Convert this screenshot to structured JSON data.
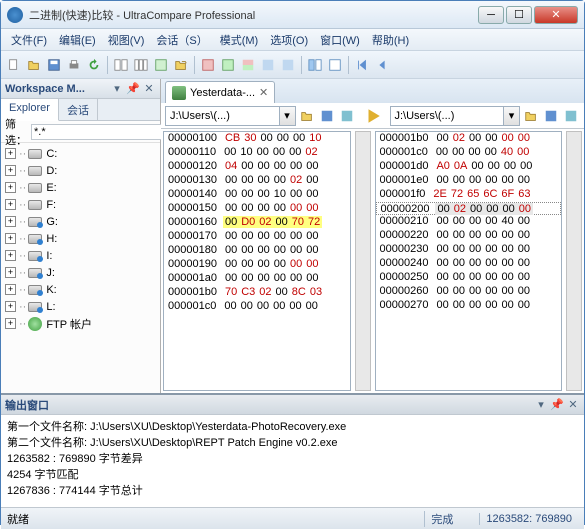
{
  "window": {
    "title": "二进制(快速)比较 - UltraCompare Professional"
  },
  "menu": [
    "文件(F)",
    "编辑(E)",
    "视图(V)",
    "会话（S）",
    "模式(M)",
    "选项(O)",
    "窗口(W)",
    "帮助(H)"
  ],
  "workspace_panel": {
    "title": "Workspace M...",
    "tabs": [
      "Explorer",
      "会话"
    ],
    "filter_label": "筛选：",
    "filter_value": "*.*",
    "drives": [
      {
        "label": "C:",
        "type": "local"
      },
      {
        "label": "D:",
        "type": "local"
      },
      {
        "label": "E:",
        "type": "local"
      },
      {
        "label": "F:",
        "type": "local"
      },
      {
        "label": "G:",
        "type": "net"
      },
      {
        "label": "H:",
        "type": "net"
      },
      {
        "label": "I:",
        "type": "net"
      },
      {
        "label": "J:",
        "type": "net"
      },
      {
        "label": "K:",
        "type": "net"
      },
      {
        "label": "L:",
        "type": "net"
      },
      {
        "label": "FTP 帐户",
        "type": "ftp"
      }
    ]
  },
  "doc_tab": "Yesterdata-...",
  "paths": {
    "left": "J:\\Users\\(...)",
    "right": "J:\\Users\\(...)"
  },
  "hex_left": [
    {
      "addr": "00000100",
      "bytes": [
        [
          "CB",
          "r"
        ],
        [
          "30",
          "r"
        ],
        [
          "00",
          "n"
        ],
        [
          "00",
          "n"
        ],
        [
          "00",
          "n"
        ],
        [
          "10",
          "r"
        ]
      ]
    },
    {
      "addr": "00000110",
      "bytes": [
        [
          "00",
          "n"
        ],
        [
          "10",
          "n"
        ],
        [
          "00",
          "n"
        ],
        [
          "00",
          "n"
        ],
        [
          "00",
          "n"
        ],
        [
          "02",
          "r"
        ]
      ]
    },
    {
      "addr": "00000120",
      "bytes": [
        [
          "04",
          "r"
        ],
        [
          "00",
          "n"
        ],
        [
          "00",
          "n"
        ],
        [
          "00",
          "n"
        ],
        [
          "00",
          "n"
        ],
        [
          "00",
          "n"
        ]
      ]
    },
    {
      "addr": "00000130",
      "bytes": [
        [
          "00",
          "n"
        ],
        [
          "00",
          "n"
        ],
        [
          "00",
          "n"
        ],
        [
          "00",
          "n"
        ],
        [
          "02",
          "r"
        ],
        [
          "00",
          "n"
        ]
      ]
    },
    {
      "addr": "00000140",
      "bytes": [
        [
          "00",
          "n"
        ],
        [
          "00",
          "n"
        ],
        [
          "00",
          "n"
        ],
        [
          "10",
          "n"
        ],
        [
          "00",
          "n"
        ],
        [
          "00",
          "n"
        ]
      ]
    },
    {
      "addr": "00000150",
      "bytes": [
        [
          "00",
          "n"
        ],
        [
          "00",
          "n"
        ],
        [
          "00",
          "n"
        ],
        [
          "00",
          "n"
        ],
        [
          "00",
          "r"
        ],
        [
          "00",
          "r"
        ]
      ]
    },
    {
      "addr": "00000160",
      "bytes": [
        [
          "00",
          "n",
          "y"
        ],
        [
          "D0",
          "r",
          "y"
        ],
        [
          "02",
          "r",
          "y"
        ],
        [
          "00",
          "n",
          "y"
        ],
        [
          "70",
          "r",
          "y"
        ],
        [
          "72",
          "r",
          "y"
        ]
      ]
    },
    {
      "addr": "00000170",
      "bytes": [
        [
          "00",
          "n"
        ],
        [
          "00",
          "n"
        ],
        [
          "00",
          "n"
        ],
        [
          "00",
          "n"
        ],
        [
          "00",
          "n"
        ],
        [
          "00",
          "n"
        ]
      ]
    },
    {
      "addr": "00000180",
      "bytes": [
        [
          "00",
          "n"
        ],
        [
          "00",
          "n"
        ],
        [
          "00",
          "n"
        ],
        [
          "00",
          "n"
        ],
        [
          "00",
          "n"
        ],
        [
          "00",
          "n"
        ]
      ]
    },
    {
      "addr": "00000190",
      "bytes": [
        [
          "00",
          "n"
        ],
        [
          "00",
          "n"
        ],
        [
          "00",
          "n"
        ],
        [
          "00",
          "n"
        ],
        [
          "00",
          "r"
        ],
        [
          "00",
          "r"
        ]
      ]
    },
    {
      "addr": "000001a0",
      "bytes": [
        [
          "00",
          "n"
        ],
        [
          "00",
          "n"
        ],
        [
          "00",
          "n"
        ],
        [
          "00",
          "n"
        ],
        [
          "00",
          "n"
        ],
        [
          "00",
          "n"
        ]
      ]
    },
    {
      "addr": "000001b0",
      "bytes": [
        [
          "70",
          "r"
        ],
        [
          "C3",
          "r"
        ],
        [
          "02",
          "r"
        ],
        [
          "00",
          "n"
        ],
        [
          "8C",
          "r"
        ],
        [
          "03",
          "r"
        ]
      ]
    },
    {
      "addr": "000001c0",
      "bytes": [
        [
          "00",
          "n"
        ],
        [
          "00",
          "n"
        ],
        [
          "00",
          "n"
        ],
        [
          "00",
          "n"
        ],
        [
          "00",
          "n"
        ],
        [
          "00",
          "n"
        ]
      ]
    }
  ],
  "hex_right": [
    {
      "addr": "000001b0",
      "bytes": [
        [
          "00",
          "n"
        ],
        [
          "02",
          "r"
        ],
        [
          "00",
          "n"
        ],
        [
          "00",
          "n"
        ],
        [
          "00",
          "r"
        ],
        [
          "00",
          "r"
        ]
      ]
    },
    {
      "addr": "000001c0",
      "bytes": [
        [
          "00",
          "n"
        ],
        [
          "00",
          "n"
        ],
        [
          "00",
          "n"
        ],
        [
          "00",
          "n"
        ],
        [
          "40",
          "r"
        ],
        [
          "00",
          "r"
        ]
      ]
    },
    {
      "addr": "000001d0",
      "bytes": [
        [
          "A0",
          "r"
        ],
        [
          "0A",
          "r"
        ],
        [
          "00",
          "n"
        ],
        [
          "00",
          "n"
        ],
        [
          "00",
          "n"
        ],
        [
          "00",
          "n"
        ]
      ]
    },
    {
      "addr": "000001e0",
      "bytes": [
        [
          "00",
          "n"
        ],
        [
          "00",
          "n"
        ],
        [
          "00",
          "n"
        ],
        [
          "00",
          "n"
        ],
        [
          "00",
          "n"
        ],
        [
          "00",
          "n"
        ]
      ]
    },
    {
      "addr": "000001f0",
      "bytes": [
        [
          "2E",
          "r"
        ],
        [
          "72",
          "r"
        ],
        [
          "65",
          "r"
        ],
        [
          "6C",
          "r"
        ],
        [
          "6F",
          "r"
        ],
        [
          "63",
          "r"
        ]
      ]
    },
    {
      "addr": "00000200",
      "bytes": [
        [
          "00",
          "n",
          "g"
        ],
        [
          "02",
          "r",
          "g"
        ],
        [
          "00",
          "n",
          "g"
        ],
        [
          "00",
          "n",
          "g"
        ],
        [
          "00",
          "n",
          "g"
        ],
        [
          "00",
          "r",
          "g"
        ]
      ],
      "current": true
    },
    {
      "addr": "00000210",
      "bytes": [
        [
          "00",
          "n"
        ],
        [
          "00",
          "n"
        ],
        [
          "00",
          "n"
        ],
        [
          "00",
          "n"
        ],
        [
          "40",
          "n"
        ],
        [
          "00",
          "n"
        ]
      ]
    },
    {
      "addr": "00000220",
      "bytes": [
        [
          "00",
          "n"
        ],
        [
          "00",
          "n"
        ],
        [
          "00",
          "n"
        ],
        [
          "00",
          "n"
        ],
        [
          "00",
          "n"
        ],
        [
          "00",
          "n"
        ]
      ]
    },
    {
      "addr": "00000230",
      "bytes": [
        [
          "00",
          "n"
        ],
        [
          "00",
          "n"
        ],
        [
          "00",
          "n"
        ],
        [
          "00",
          "n"
        ],
        [
          "00",
          "n"
        ],
        [
          "00",
          "n"
        ]
      ]
    },
    {
      "addr": "00000240",
      "bytes": [
        [
          "00",
          "n"
        ],
        [
          "00",
          "n"
        ],
        [
          "00",
          "n"
        ],
        [
          "00",
          "n"
        ],
        [
          "00",
          "n"
        ],
        [
          "00",
          "n"
        ]
      ]
    },
    {
      "addr": "00000250",
      "bytes": [
        [
          "00",
          "n"
        ],
        [
          "00",
          "n"
        ],
        [
          "00",
          "n"
        ],
        [
          "00",
          "n"
        ],
        [
          "00",
          "n"
        ],
        [
          "00",
          "n"
        ]
      ]
    },
    {
      "addr": "00000260",
      "bytes": [
        [
          "00",
          "n"
        ],
        [
          "00",
          "n"
        ],
        [
          "00",
          "n"
        ],
        [
          "00",
          "n"
        ],
        [
          "00",
          "n"
        ],
        [
          "00",
          "n"
        ]
      ]
    },
    {
      "addr": "00000270",
      "bytes": [
        [
          "00",
          "n"
        ],
        [
          "00",
          "n"
        ],
        [
          "00",
          "n"
        ],
        [
          "00",
          "n"
        ],
        [
          "00",
          "n"
        ],
        [
          "00",
          "n"
        ]
      ]
    }
  ],
  "output_panel": {
    "title": "输出窗口",
    "lines": [
      "第一个文件名称:  J:\\Users\\XU\\Desktop\\Yesterdata-PhotoRecovery.exe",
      "第二个文件名称:  J:\\Users\\XU\\Desktop\\REPT Patch Engine v0.2.exe",
      "1263582 : 769890  字节差异",
      "4254  字节匹配",
      "1267836 : 774144  字节总计"
    ]
  },
  "status": {
    "left": "就绪",
    "done": "完成",
    "pos": "1263582: 769890"
  }
}
